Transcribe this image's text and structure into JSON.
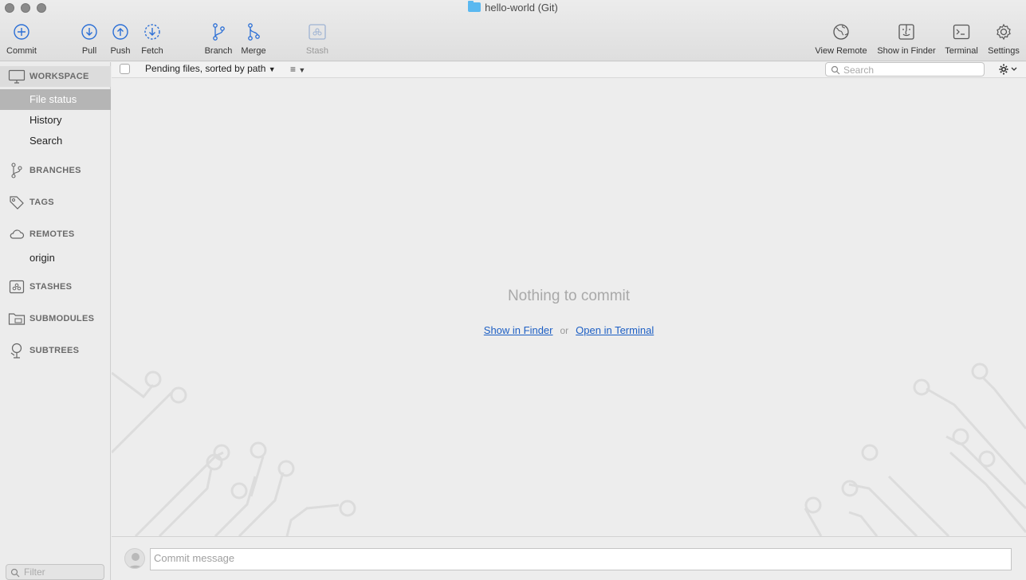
{
  "window": {
    "title": "hello-world (Git)"
  },
  "toolbar": {
    "commit": "Commit",
    "pull": "Pull",
    "push": "Push",
    "fetch": "Fetch",
    "branch": "Branch",
    "merge": "Merge",
    "stash": "Stash",
    "view_remote": "View Remote",
    "show_in_finder": "Show in Finder",
    "terminal": "Terminal",
    "settings": "Settings"
  },
  "sidebar": {
    "workspace": "WORKSPACE",
    "workspace_items": [
      "File status",
      "History",
      "Search"
    ],
    "branches": "BRANCHES",
    "tags": "TAGS",
    "remotes": "REMOTES",
    "remote_items": [
      "origin"
    ],
    "stashes": "STASHES",
    "submodules": "SUBMODULES",
    "subtrees": "SUBTREES",
    "filter_placeholder": "Filter"
  },
  "main": {
    "sort_label": "Pending files, sorted by path",
    "search_placeholder": "Search",
    "empty_message": "Nothing to commit",
    "show_in_finder_link": "Show in Finder",
    "or_text": "or",
    "open_in_terminal_link": "Open in Terminal",
    "commit_placeholder": "Commit message"
  },
  "colors": {
    "accent": "#2b6fd6",
    "link": "#1d5fc4",
    "selection": "#b5b5b5"
  }
}
